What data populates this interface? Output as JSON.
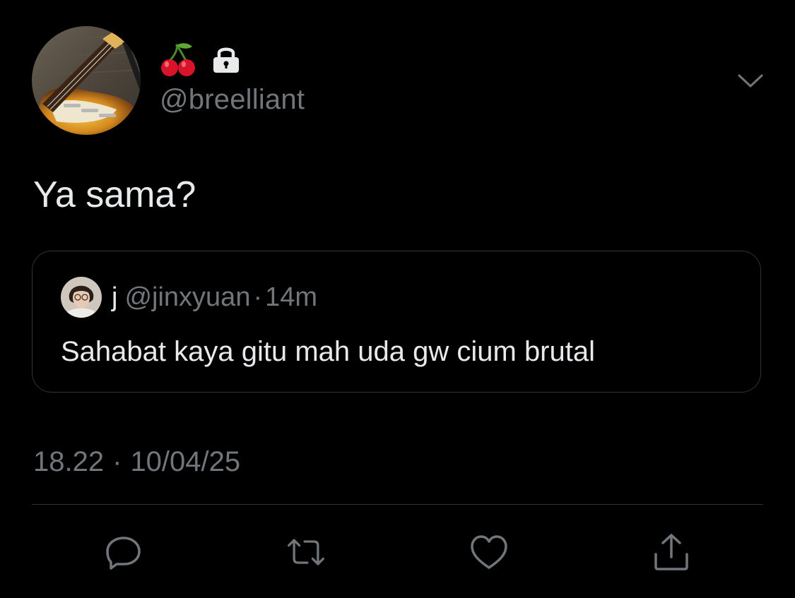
{
  "author": {
    "display_emoji": "🍒",
    "handle": "@breelliant",
    "protected": true,
    "avatar": "guitar-photo"
  },
  "tweet": {
    "text": "Ya sama?"
  },
  "quoted_tweet": {
    "name": "j",
    "handle": "@jinxyuan",
    "separator": "·",
    "time_ago": "14m",
    "text": "Sahabat kaya gitu mah uda gw cium brutal",
    "avatar": "person-photo"
  },
  "meta": {
    "time": "18.22",
    "separator": "·",
    "date": "10/04/25"
  },
  "actions": [
    "reply-icon",
    "retweet-icon",
    "like-icon",
    "share-icon"
  ],
  "colors": {
    "background": "#000000",
    "primary_text": "#e7e9ea",
    "secondary_text": "#71767b",
    "border": "#2f3336",
    "cherry": "#d9142a"
  }
}
